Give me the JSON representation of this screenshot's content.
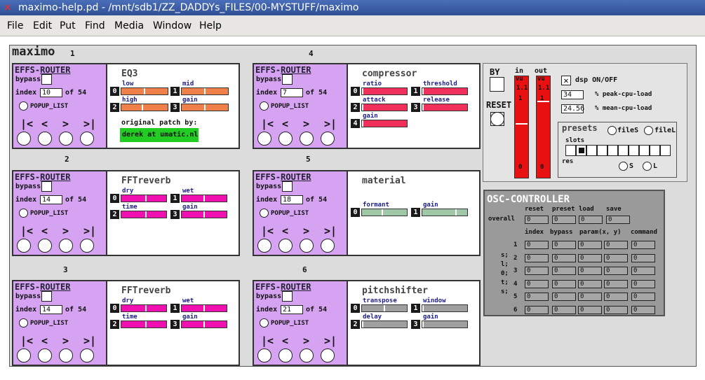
{
  "window": {
    "title": "maximo-help.pd  - /mnt/sdb1/ZZ_DADDYs_FILES/00-MYSTUFF/maximo"
  },
  "menu": [
    "File",
    "Edit",
    "Put",
    "Find",
    "Media",
    "Window",
    "Help"
  ],
  "patch": {
    "name": "maximo"
  },
  "colors": {
    "router": "#d6a2f2",
    "orange": "#f0804a",
    "red": "#f0305a",
    "pink": "#f010b0",
    "green": "#a0c8a8",
    "gray": "#a0a0a0",
    "osc": "#9a9a9a",
    "vu": "#e81010",
    "patch_box": "#22cc22"
  },
  "router": {
    "title_a": "EFFS-",
    "title_b": "ROUTER",
    "bypass_label": "bypass",
    "index_label": "index",
    "of_label": "of 54",
    "popup_label": "POPUP_LIST",
    "nav": [
      "|<",
      "<",
      ">",
      ">|"
    ]
  },
  "units": [
    {
      "num": "1",
      "index": "10",
      "effect": "EQ3",
      "params": [
        {
          "label": "low",
          "value": 0.5
        },
        {
          "label": "mid",
          "value": 0.5
        },
        {
          "label": "high",
          "value": 0.45
        },
        {
          "label": "gain",
          "value": 0.5
        }
      ],
      "note": "original patch by:",
      "credit": "derek at umatic.nl"
    },
    {
      "num": "4",
      "index": "7",
      "effect": "compressor",
      "params": [
        {
          "label": "ratio",
          "value": 0
        },
        {
          "label": "threshold",
          "value": 0
        },
        {
          "label": "attack",
          "value": 0
        },
        {
          "label": "release",
          "value": 0
        },
        {
          "label": "gain",
          "value": 0
        }
      ]
    },
    {
      "num": "2",
      "index": "14",
      "effect": "FFTreverb",
      "params": [
        {
          "label": "dry",
          "value": 0.55
        },
        {
          "label": "wet",
          "value": 0.5
        },
        {
          "label": "time",
          "value": 0.55
        },
        {
          "label": "gain",
          "value": 0.5
        }
      ]
    },
    {
      "num": "5",
      "index": "18",
      "effect": "material",
      "params": [
        {
          "label": "formant",
          "value": 0.45
        },
        {
          "label": "gain",
          "value": 0.75
        }
      ]
    },
    {
      "num": "3",
      "index": "14",
      "effect": "FFTreverb",
      "params": [
        {
          "label": "dry",
          "value": 0.55
        },
        {
          "label": "wet",
          "value": 0.5
        },
        {
          "label": "time",
          "value": 0.55
        },
        {
          "label": "gain",
          "value": 0.5
        }
      ]
    },
    {
      "num": "6",
      "index": "21",
      "effect": "pitchshifter",
      "params": [
        {
          "label": "transpose",
          "value": 0.5
        },
        {
          "label": "window",
          "value": 0
        },
        {
          "label": "delay",
          "value": 0
        },
        {
          "label": "gain",
          "value": 0
        }
      ]
    }
  ],
  "control": {
    "by_label": "BY",
    "reset_label": "RESET",
    "in_label": "in",
    "out_label": "out",
    "vu_top": "vu",
    "vu_clip": "1.1",
    "vu_mark": "1",
    "vu_zero": "0",
    "dsp_label": "dsp ON/OFF",
    "peak_value": "34",
    "peak_label": "% peak-cpu-load",
    "mean_value": "24.56",
    "mean_label": "% mean-cpu-load",
    "presets_title": "presets",
    "file_s": "fileS",
    "file_l": "fileL",
    "slots_label": "slots",
    "slots_count": 10,
    "slot_selected": 1,
    "res_label": "res",
    "s_label": "S",
    "l_label": "L"
  },
  "osc": {
    "title": "OSC-CONTROLLER",
    "top_headers": [
      "reset",
      "preset",
      "load",
      "save"
    ],
    "overall_label": "overall",
    "overall_values": [
      "0",
      "0",
      "0",
      "0"
    ],
    "headers": [
      "index",
      "bypass",
      "param(x, y)",
      "command"
    ],
    "rows": [
      "1",
      "2",
      "3",
      "4",
      "5",
      "6"
    ],
    "side": [
      "s;",
      "l;",
      "0;",
      "t;",
      "s;"
    ],
    "cell_value": "0"
  }
}
